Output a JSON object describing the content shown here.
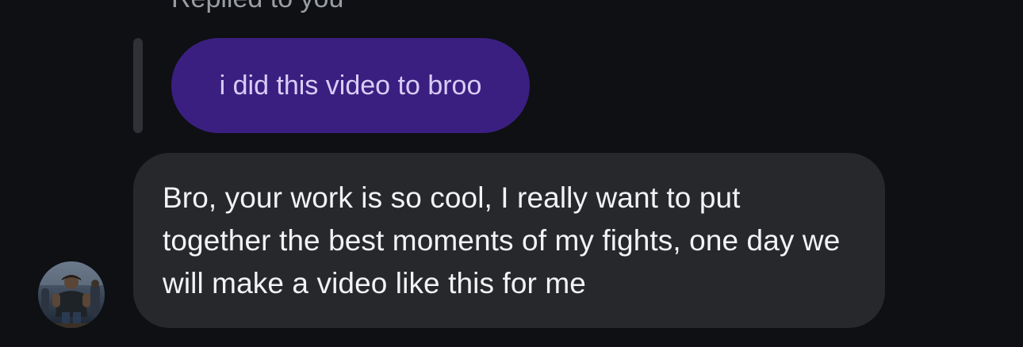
{
  "thread": {
    "replied_label": "Replied to you",
    "quoted_message": {
      "text": "i did this video to broo",
      "bubble_color": "#3b1f80",
      "text_color": "#d9cdf7"
    },
    "message": {
      "text": "Bro, your work is so cool, I really want to put together the best moments of my fights, one day we will make a video like this for me",
      "bubble_color": "#26282c",
      "text_color": "#f2f3f5"
    },
    "sender": {
      "avatar_icon": "profile-photo"
    }
  },
  "colors": {
    "background": "#0e1013",
    "reply_bar": "#2f3136",
    "meta_text": "#9a9da3"
  }
}
